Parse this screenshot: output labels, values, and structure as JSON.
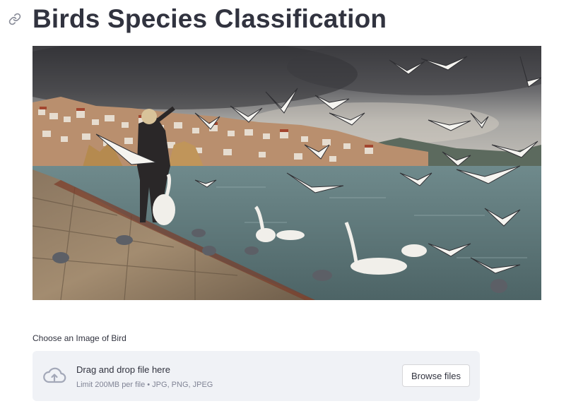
{
  "page": {
    "title": "Birds Species Classification"
  },
  "hero_image": {
    "alt": "Flock of gulls and swans on a lakeside promenade"
  },
  "uploader": {
    "label": "Choose an Image of Bird",
    "drop_text": "Drag and drop file here",
    "limit_text": "Limit 200MB per file • JPG, PNG, JPEG",
    "browse_label": "Browse files",
    "upload_icon": "cloud-upload-icon",
    "anchor_icon": "link-icon"
  },
  "colors": {
    "text": "#31333f",
    "muted": "#808495",
    "dropzone_bg": "#f0f2f6",
    "icon": "#a3a8b8"
  }
}
